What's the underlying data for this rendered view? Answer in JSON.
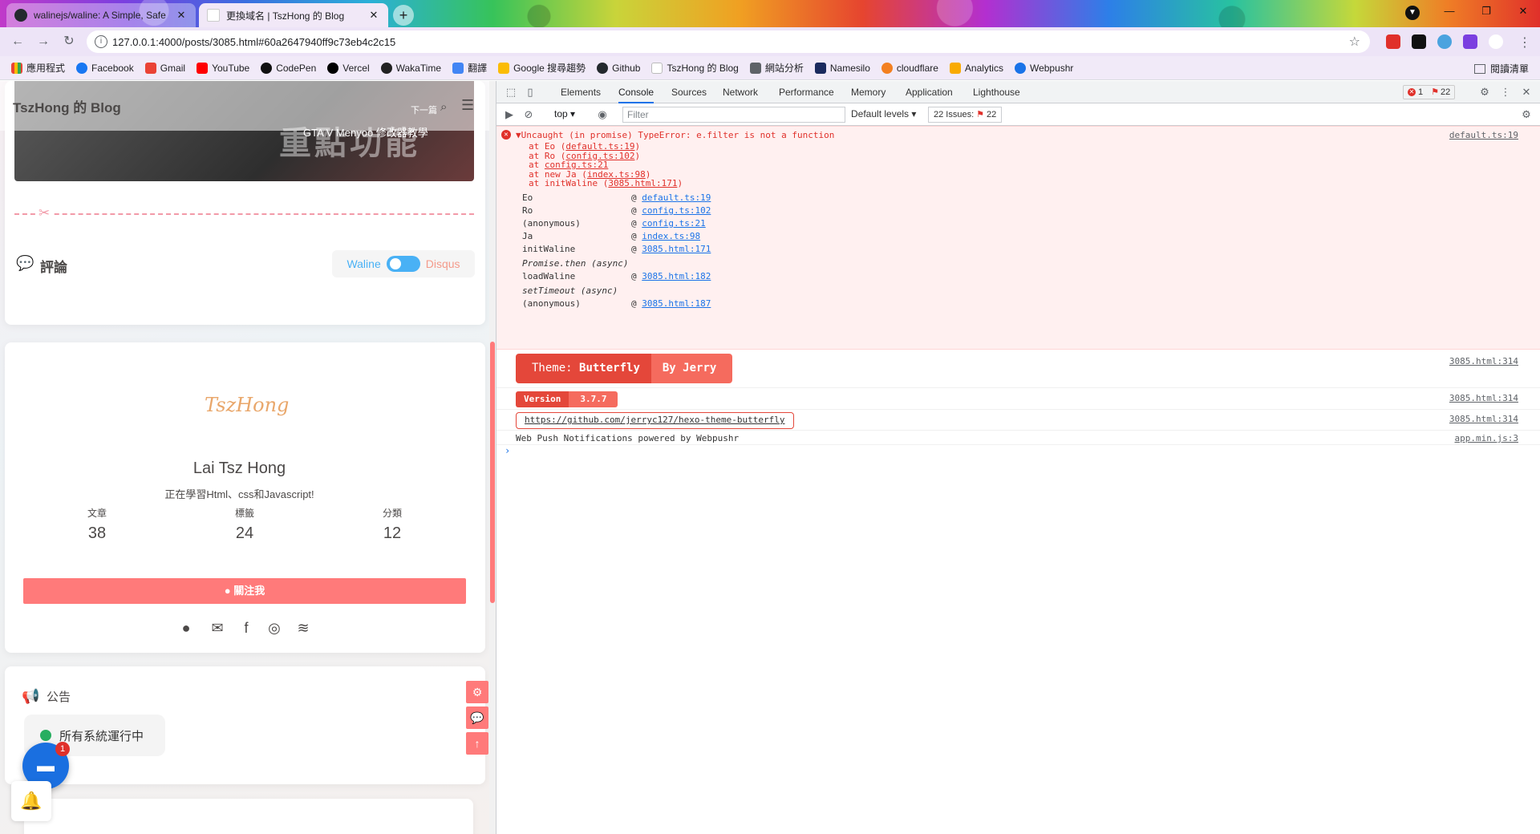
{
  "browser": {
    "tabs": [
      {
        "title": "walinejs/waline: A Simple, Safe",
        "active": false
      },
      {
        "title": "更換域名 | TszHong 的 Blog",
        "active": true
      }
    ],
    "new_tab_icon": "plus-icon",
    "address": "127.0.0.1:4000/posts/3085.html#60a2647940ff9c73eb4c2c15",
    "bookmarks": [
      "應用程式",
      "Facebook",
      "Gmail",
      "YouTube",
      "CodePen",
      "Vercel",
      "WakaTime",
      "翻譯",
      "Google 搜尋趨勢",
      "Github",
      "TszHong 的 Blog",
      "網站分析",
      "Namesilo",
      "cloudflare",
      "Analytics",
      "Webpushr"
    ],
    "reading_list": "閱讀清單"
  },
  "page": {
    "site_title": "TszHong 的 Blog",
    "next_label": "下一篇",
    "banner_title": "重點功能",
    "banner_subtitle": "GTA V Menyoo 修改器教學",
    "comments_title": "評論",
    "comment_switch": {
      "left": "Waline",
      "right": "Disqus"
    },
    "author": {
      "logo_text": "TszHong",
      "name": "Lai Tsz Hong",
      "description": "正在學習Html、css和Javascript!",
      "stats": [
        {
          "label": "文章",
          "value": "38"
        },
        {
          "label": "標籤",
          "value": "24"
        },
        {
          "label": "分類",
          "value": "12"
        }
      ],
      "follow_button": "關注我"
    },
    "notice_title": "公告",
    "status_text": "所有系統運行中",
    "chat_badge": "1"
  },
  "devtools": {
    "tabs": [
      "Elements",
      "Console",
      "Sources",
      "Network",
      "Performance",
      "Memory",
      "Application",
      "Lighthouse"
    ],
    "active_tab": "Console",
    "error_count": "1",
    "issue_count": "22",
    "context": "top",
    "filter_placeholder": "Filter",
    "default_levels": "Default levels",
    "issues_label": "22 Issues:",
    "issues_num": "22",
    "error": {
      "message": "▼Uncaught (in promise) TypeError: e.filter is not a function",
      "source": "default.ts:19",
      "stack_lines": [
        {
          "prefix": "at Eo (",
          "link": "default.ts:19",
          "suffix": ")"
        },
        {
          "prefix": "at Ro (",
          "link": "config.ts:102",
          "suffix": ")"
        },
        {
          "prefix": "at ",
          "link": "config.ts:21",
          "suffix": ""
        },
        {
          "prefix": "at new Ja (",
          "link": "index.ts:98",
          "suffix": ")"
        },
        {
          "prefix": "at initWaline (",
          "link": "3085.html:171",
          "suffix": ")"
        }
      ],
      "call_stack": [
        {
          "fn": "Eo",
          "loc": "default.ts:19"
        },
        {
          "fn": "Ro",
          "loc": "config.ts:102"
        },
        {
          "fn": "(anonymous)",
          "loc": "config.ts:21"
        },
        {
          "fn": "Ja",
          "loc": "index.ts:98"
        },
        {
          "fn": "initWaline",
          "loc": "3085.html:171"
        },
        {
          "fn": "Promise.then (async)",
          "loc": ""
        },
        {
          "fn": "loadWaline",
          "loc": "3085.html:182"
        },
        {
          "fn": "setTimeout (async)",
          "loc": ""
        },
        {
          "fn": "(anonymous)",
          "loc": "3085.html:187"
        }
      ]
    },
    "theme_badge": {
      "left_prefix": "Theme: ",
      "left_name": "Butterfly",
      "right": "By Jerry",
      "source": "3085.html:314"
    },
    "version_badge": {
      "left": "Version",
      "right": "3.7.7",
      "source": "3085.html:314"
    },
    "repo_link": {
      "url": "https://github.com/jerryc127/hexo-theme-butterfly",
      "source": "3085.html:314"
    },
    "webpush": {
      "text": "Web Push Notifications powered by Webpushr",
      "source": "app.min.js:3"
    },
    "prompt": "›"
  }
}
